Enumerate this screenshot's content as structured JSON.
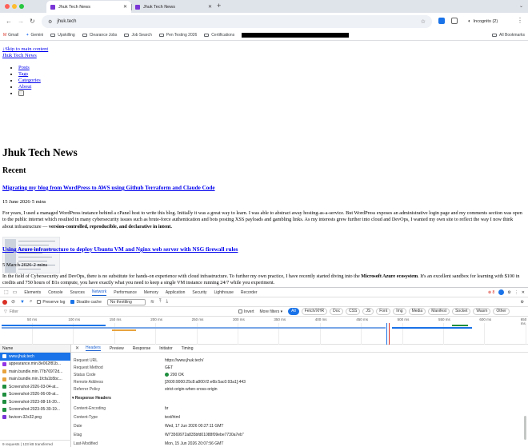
{
  "browser": {
    "tabs": [
      {
        "title": "Jhuk Tech News",
        "active": true
      },
      {
        "title": "Jhuk Tech News",
        "active": false
      }
    ],
    "new_tab_label": "+",
    "url": "jhuk.tech",
    "incognito_label": "Incognito (2)",
    "accent": "#7a35d6"
  },
  "bookmarks": {
    "items": [
      "Gmail",
      "Gemini",
      "Upskilling",
      "Clearance Jobs",
      "Job Search",
      "Pen Testing 2026",
      "Certifications"
    ],
    "all_label": "All Bookmarks"
  },
  "page": {
    "skip_link": "Skip to main content",
    "site_title": "Jhuk Tech News",
    "nav": [
      "Posts",
      "Tags",
      "Categories",
      "About"
    ],
    "heading": "Jhuk Tech News",
    "section": "Recent",
    "posts": [
      {
        "title": "Migrating my blog from WordPress to AWS using Github Terraform and Claude Code",
        "meta": "15 June 2026·5 mins",
        "excerpt_plain": "For years, I used a managed WordPress instance behind a cPanel host to write this blog. Initially it was a great way to learn. I was able to abstract away hosting-as-a-service. But WordPress exposes an administrative login page and my comments section was open to the public internet which resulted in many cybersecurity issues such as brute-force authentication and bots posting XSS payloads and gambling links. As my interests grew further into cloud and DevOps, I wanted my own site to reflect the way I now think about infrastructure — ",
        "excerpt_bold": "version-controlled, reproducible, and declarative in intent."
      },
      {
        "title": "Using Azure infrastructure to deploy Ubuntu VM and Nginx web server with NSG firewall rules",
        "meta": "5 March 2026·2 mins",
        "excerpt_plain": "In the field of Cybersecurity and DevOps, there is no substitute for hands-on experience with cloud infrastructure. To further my own practice, I have recently started diving into the ",
        "excerpt_bold": "Microsoft Azure ecosystem",
        "excerpt_tail": ". It's an excellent sandbox for learning with $100 in credits and 750 hours of B1s compute, you have exactly what you need to keep a single VM instance running 24/7 while you experiment."
      }
    ]
  },
  "devtools": {
    "tabs": [
      "Elements",
      "Console",
      "Sources",
      "Network",
      "Performance",
      "Memory",
      "Application",
      "Security",
      "Lighthouse",
      "Recorder"
    ],
    "active_tab": "Network",
    "error_count": "8",
    "toolbar": {
      "preserve_log": "Preserve log",
      "disable_cache": "Disable cache",
      "throttling": "No throttling"
    },
    "filter": {
      "placeholder": "Filter",
      "invert": "Invert",
      "more_filters": "More filters",
      "types": [
        "All",
        "Fetch/XHR",
        "Doc",
        "CSS",
        "JS",
        "Font",
        "Img",
        "Media",
        "Manifest",
        "Socket",
        "Wasm",
        "Other"
      ]
    },
    "timeline_ticks": [
      "50 ms",
      "100 ms",
      "150 ms",
      "200 ms",
      "250 ms",
      "300 ms",
      "350 ms",
      "400 ms",
      "450 ms",
      "500 ms",
      "550 ms",
      "600 ms",
      "650 ms"
    ],
    "requests_header": "Name",
    "requests": [
      {
        "name": "www.jhuk.tech",
        "type": "doc",
        "color": "#1a73e8"
      },
      {
        "name": "appearance.min.8e062f81b...",
        "type": "css",
        "color": "#9334e6"
      },
      {
        "name": "main.bundle.min.77b76972d...",
        "type": "js",
        "color": "#e8a33d"
      },
      {
        "name": "main.bundle.min.1fcfa1b5bc...",
        "type": "js",
        "color": "#e8a33d"
      },
      {
        "name": "Screenshot-2026-03-04-at...",
        "type": "img",
        "color": "#1e8e3e"
      },
      {
        "name": "Screenshot-2026-06-09-at...",
        "type": "img",
        "color": "#1e8e3e"
      },
      {
        "name": "Screenshot-2023-08-16-20...",
        "type": "img",
        "color": "#1e8e3e"
      },
      {
        "name": "Screenshot-2023-05-30-19...",
        "type": "img",
        "color": "#1e8e3e"
      },
      {
        "name": "favicon-32x32.png",
        "type": "img",
        "color": "#7a35d6"
      }
    ],
    "footer": "9 requests | 123 kB transferred",
    "detail_tabs": [
      "Headers",
      "Preview",
      "Response",
      "Initiator",
      "Timing"
    ],
    "headers": [
      {
        "key": "Request URL",
        "value": "https://www.jhuk.tech/"
      },
      {
        "key": "Request Method",
        "value": "GET"
      },
      {
        "key": "Status Code",
        "value": "200 OK"
      },
      {
        "key": "Remote Address",
        "value": "[2600:9000:25c8:a800:f2:e6b:5ac0:93a1]:443"
      },
      {
        "key": "Referrer Policy",
        "value": "strict-origin-when-cross-origin"
      }
    ],
    "response_section": "Response Headers",
    "response_headers": [
      {
        "key": "Content-Encoding",
        "value": "br"
      },
      {
        "key": "Content-Type",
        "value": "text/html"
      },
      {
        "key": "Date",
        "value": "Wed, 17 Jun 2026 00:27:11 GMT"
      },
      {
        "key": "Etag",
        "value": "W/\"3569972a835bfd01088f09ebe7730a7eb\""
      },
      {
        "key": "Last-Modified",
        "value": "Mon, 15 Jun 2026 20:07:56 GMT"
      }
    ]
  }
}
